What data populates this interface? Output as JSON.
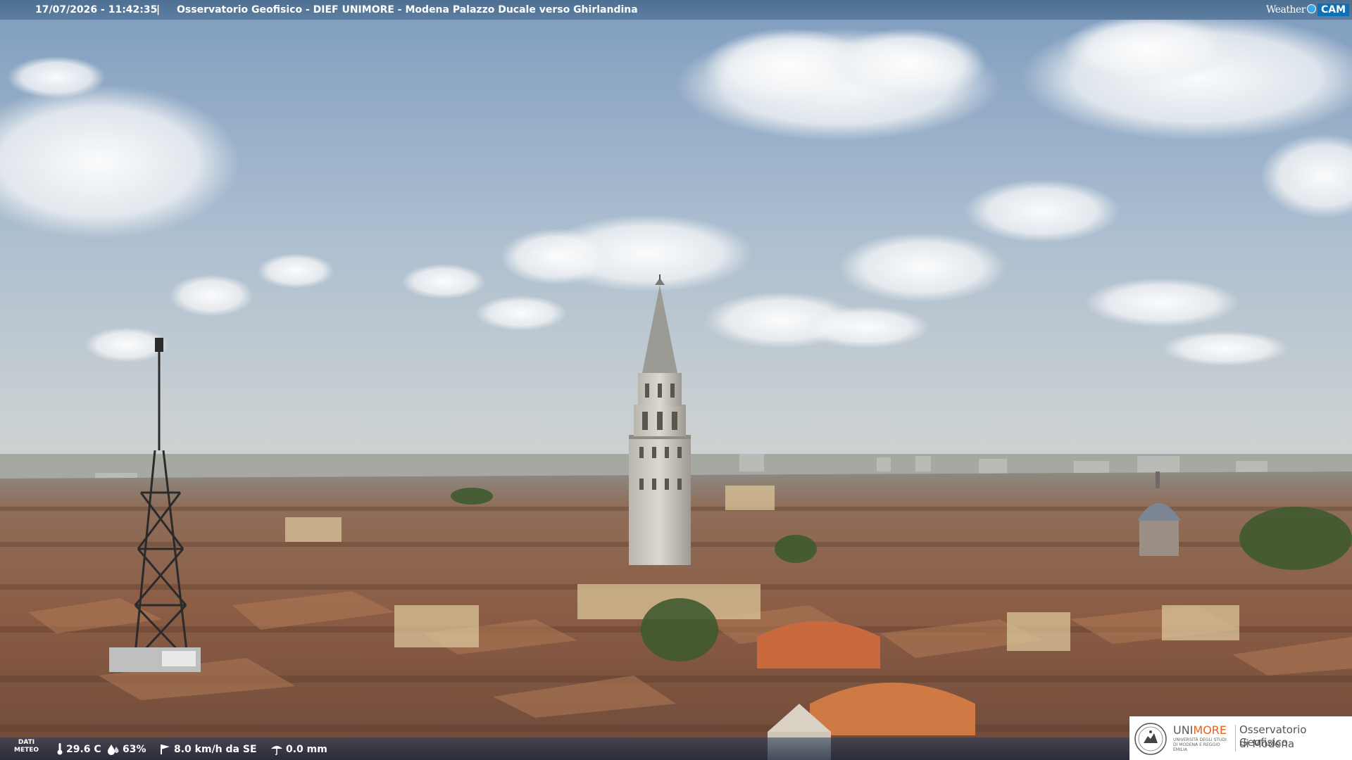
{
  "header": {
    "timestamp": "17/07/2026 - 11:42:35",
    "separator": "|",
    "title": "Osservatorio Geofisico - DIEF UNIMORE - Modena Palazzo Ducale verso Ghirlandina"
  },
  "brand": {
    "weather": "Weather",
    "cam": "CAM"
  },
  "meteo": {
    "label_line1": "DATI",
    "label_line2": "METEO",
    "temperature": "29.6 C",
    "humidity": "63%",
    "wind": "8.0 km/h da SE",
    "rain": "0.0 mm"
  },
  "logo": {
    "uni_prefix": "UNI",
    "uni_suffix": "MORE",
    "university_small": "UNIVERSITÀ DEGLI STUDI DI MODENA E REGGIO EMILIA",
    "observatory_line1": "Osservatorio Geofisico",
    "observatory_line2": "di Modena"
  },
  "icons": [
    "thermometer-icon",
    "humidity-drop-icon",
    "wind-icon",
    "rain-gauge-icon"
  ],
  "colors": {
    "sky_top": "#7f9dc0",
    "sky_horizon": "#c9d0d0",
    "roof": "#9b6247",
    "banner": "#4d6f92",
    "logo_accent": "#e2651b"
  }
}
